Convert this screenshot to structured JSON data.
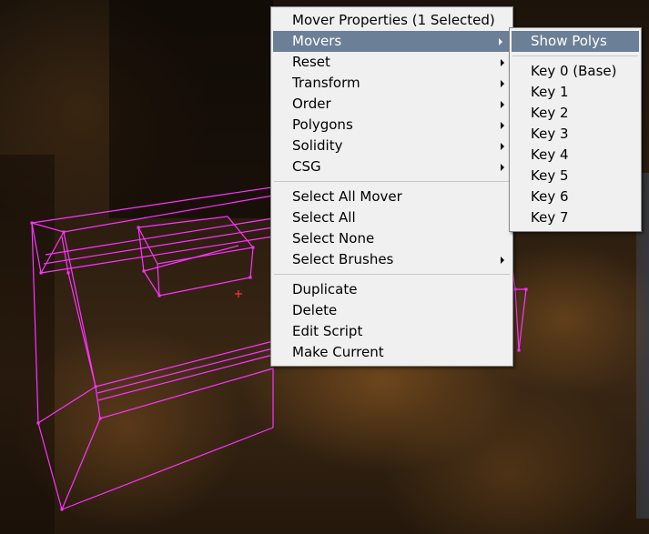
{
  "context_menu": {
    "header": "Mover Properties (1 Selected)",
    "groups": [
      [
        {
          "label": "Movers",
          "submenu": true,
          "highlighted": true
        },
        {
          "label": "Reset",
          "submenu": true
        },
        {
          "label": "Transform",
          "submenu": true
        },
        {
          "label": "Order",
          "submenu": true
        },
        {
          "label": "Polygons",
          "submenu": true
        },
        {
          "label": "Solidity",
          "submenu": true
        },
        {
          "label": "CSG",
          "submenu": true
        }
      ],
      [
        {
          "label": "Select All Mover"
        },
        {
          "label": "Select All"
        },
        {
          "label": "Select None"
        },
        {
          "label": "Select Brushes",
          "submenu": true
        }
      ],
      [
        {
          "label": "Duplicate"
        },
        {
          "label": "Delete"
        },
        {
          "label": "Edit Script"
        },
        {
          "label": "Make Current"
        }
      ]
    ]
  },
  "movers_submenu": {
    "show_polys": "Show Polys",
    "keys": [
      "Key 0 (Base)",
      "Key 1",
      "Key 2",
      "Key 3",
      "Key 4",
      "Key 5",
      "Key 6",
      "Key 7"
    ]
  },
  "colors": {
    "wireframe": "#ff33ff",
    "menu_highlight": "#6b7f96",
    "menu_bg": "#f0f0f0",
    "pivot": "#ff3333"
  }
}
